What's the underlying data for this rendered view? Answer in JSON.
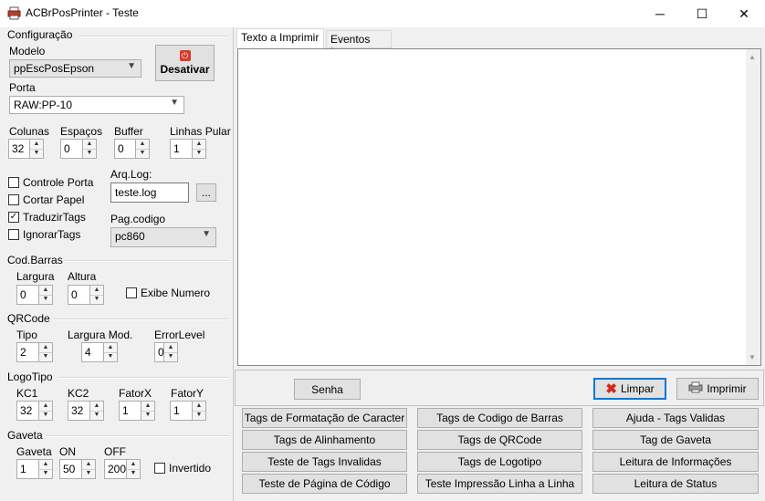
{
  "window": {
    "title": "ACBrPosPrinter - Teste",
    "minimize": "─",
    "maximize": "☐",
    "close": "✕"
  },
  "config": {
    "group_label": "Configuração",
    "modelo_label": "Modelo",
    "modelo_value": "ppEscPosEpson",
    "desativar_label": "Desativar",
    "porta_label": "Porta",
    "porta_value": "RAW:PP-10",
    "colunas_label": "Colunas",
    "colunas_value": "32",
    "espacos_label": "Espaços",
    "espacos_value": "0",
    "buffer_label": "Buffer",
    "buffer_value": "0",
    "linhas_label": "Linhas Pular",
    "linhas_value": "1",
    "controle_porta": "Controle Porta",
    "cortar_papel": "Cortar Papel",
    "traduzir_tags": "TraduzirTags",
    "ignorar_tags": "IgnorarTags",
    "arqlog_label": "Arq.Log:",
    "arqlog_value": "teste.log",
    "browse": "...",
    "pagcod_label": "Pag.codigo",
    "pagcod_value": "pc860"
  },
  "codbarras": {
    "group_label": "Cod.Barras",
    "largura_label": "Largura",
    "largura_value": "0",
    "altura_label": "Altura",
    "altura_value": "0",
    "exibe_numero": "Exibe Numero"
  },
  "qrcode": {
    "group_label": "QRCode",
    "tipo_label": "Tipo",
    "tipo_value": "2",
    "largura_label": "Largura Mod.",
    "largura_value": "4",
    "error_label": "ErrorLevel",
    "error_value": "0"
  },
  "logotipo": {
    "group_label": "LogoTipo",
    "kc1_label": "KC1",
    "kc1_value": "32",
    "kc2_label": "KC2",
    "kc2_value": "32",
    "fatorx_label": "FatorX",
    "fatorx_value": "1",
    "fatory_label": "FatorY",
    "fatory_value": "1"
  },
  "gaveta": {
    "group_label": "Gaveta",
    "gaveta_label": "Gaveta",
    "gaveta_value": "1",
    "on_label": "ON",
    "on_value": "50",
    "off_label": "OFF",
    "off_value": "200",
    "invertido": "Invertido"
  },
  "tabs": {
    "texto": "Texto a Imprimir",
    "eventos": "Eventos Log"
  },
  "actions": {
    "senha": "Senha",
    "limpar": "Limpar",
    "imprimir": "Imprimir"
  },
  "grid_buttons": [
    "Tags de Formatação de Caracter",
    "Tags de Codigo de Barras",
    "Ajuda - Tags Validas",
    "Tags de Alinhamento",
    "Tags de QRCode",
    "Tag de Gaveta",
    "Teste de Tags Invalidas",
    "Tags de Logotipo",
    "Leitura de Informações",
    "Teste de Página de Código",
    "Teste Impressão Linha a Linha",
    "Leitura de Status"
  ]
}
